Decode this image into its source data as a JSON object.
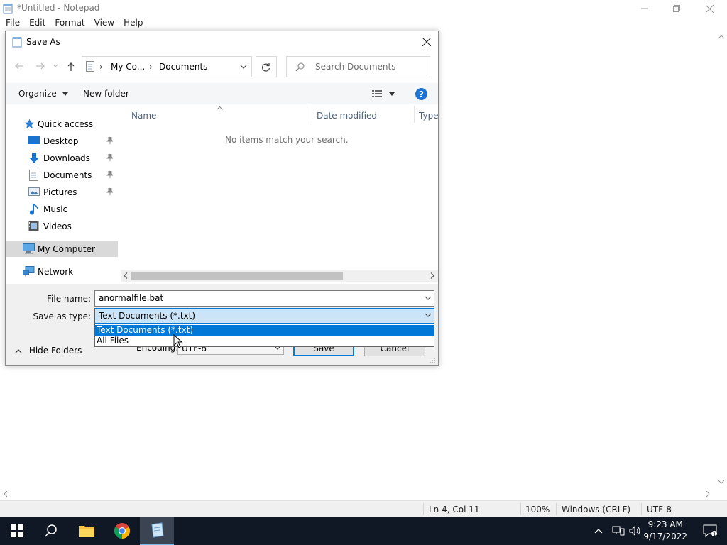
{
  "notepad": {
    "title": "*Untitled - Notepad",
    "menu": [
      "File",
      "Edit",
      "Format",
      "View",
      "Help"
    ],
    "status": {
      "position": "Ln 4, Col 11",
      "zoom": "100%",
      "line_ending": "Windows (CRLF)",
      "encoding": "UTF-8"
    }
  },
  "dialog": {
    "title": "Save As",
    "breadcrumb": [
      "My Co...",
      "Documents"
    ],
    "search_placeholder": "Search Documents",
    "toolbar": {
      "organize": "Organize",
      "new_folder": "New folder"
    },
    "nav": {
      "quick_access": "Quick access",
      "pinned": [
        {
          "label": "Desktop",
          "icon": "desktop-icon"
        },
        {
          "label": "Downloads",
          "icon": "downloads-icon"
        },
        {
          "label": "Documents",
          "icon": "documents-icon"
        },
        {
          "label": "Pictures",
          "icon": "pictures-icon"
        }
      ],
      "unpinned": [
        {
          "label": "Music",
          "icon": "music-icon"
        },
        {
          "label": "Videos",
          "icon": "videos-icon"
        }
      ],
      "my_computer": "My Computer",
      "network": "Network"
    },
    "columns": [
      "Name",
      "Date modified",
      "Type"
    ],
    "empty_message": "No items match your search.",
    "file_name_label": "File name:",
    "file_name_value": "anormalfile.bat",
    "save_type_label": "Save as type:",
    "save_type_value": "Text Documents (*.txt)",
    "save_type_options": [
      "Text Documents (*.txt)",
      "All Files"
    ],
    "encoding_label": "Encoding:",
    "encoding_value": "UTF-8",
    "save_button": "Save",
    "cancel_button": "Cancel",
    "hide_folders": "Hide Folders"
  },
  "taskbar": {
    "time": "9:23 AM",
    "date": "9/17/2022"
  },
  "colors": {
    "accent": "#0078d7",
    "taskbar": "#101826",
    "selection_bg": "#cce4f7"
  }
}
